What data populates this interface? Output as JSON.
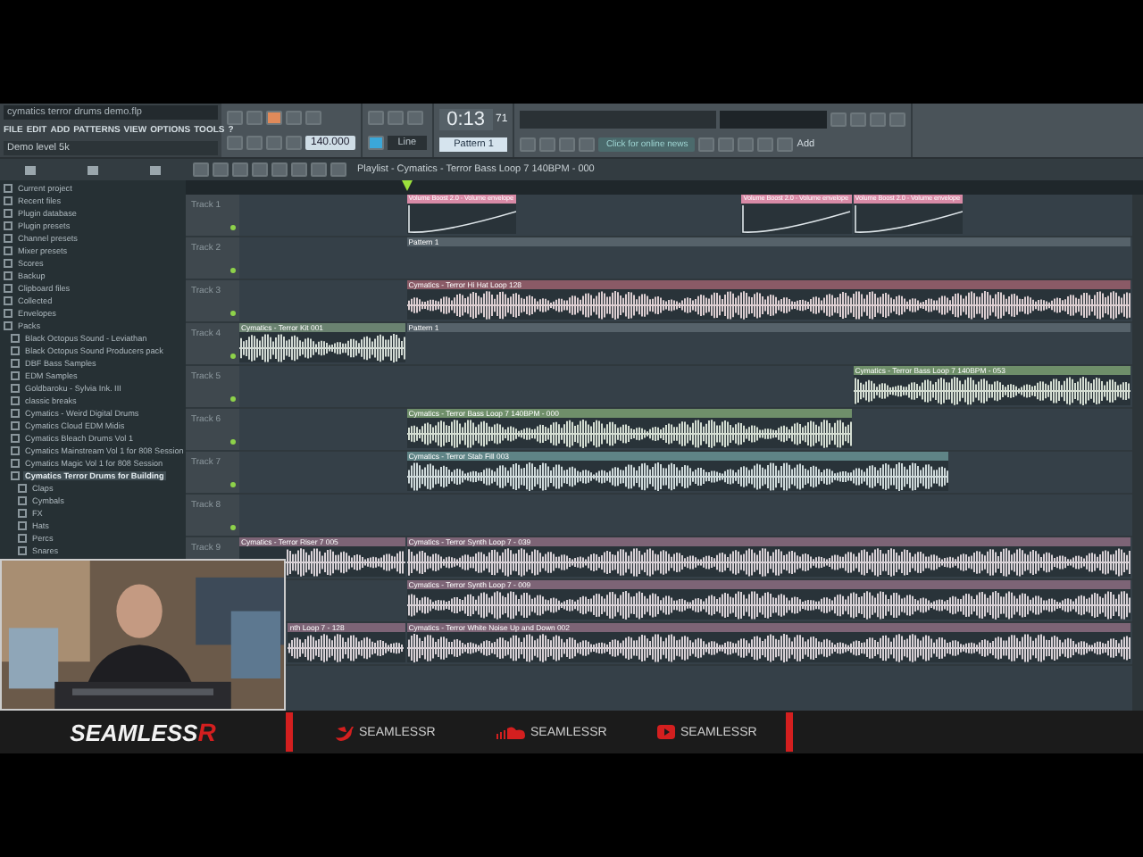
{
  "window": {
    "title": "cymatics terror drums demo.flp"
  },
  "menu": [
    "FILE",
    "EDIT",
    "ADD",
    "PATTERNS",
    "VIEW",
    "OPTIONS",
    "TOOLS",
    "?"
  ],
  "hint": "Demo level 5k",
  "transport": {
    "tempo": "140.000",
    "time": "0:13",
    "time_small": "71",
    "pattern": "Pattern 1",
    "snap": "Line",
    "news": "Click for online news",
    "add": "Add"
  },
  "browser": {
    "items": [
      {
        "label": "Current project",
        "selected": false
      },
      {
        "label": "Recent files",
        "selected": false
      },
      {
        "label": "Plugin database",
        "selected": false
      },
      {
        "label": "Plugin presets",
        "selected": false
      },
      {
        "label": "Channel presets",
        "selected": false
      },
      {
        "label": "Mixer presets",
        "selected": false
      },
      {
        "label": "Scores",
        "selected": false
      },
      {
        "label": "Backup",
        "selected": false
      },
      {
        "label": "Clipboard files",
        "selected": false
      },
      {
        "label": "Collected",
        "selected": false
      },
      {
        "label": "Envelopes",
        "selected": false
      },
      {
        "label": "Packs",
        "selected": false,
        "children": [
          {
            "label": "Black Octopus Sound - Leviathan",
            "selected": false
          },
          {
            "label": "Black Octopus Sound Producers pack",
            "selected": false
          },
          {
            "label": "DBF Bass Samples",
            "selected": false
          },
          {
            "label": "EDM Samples",
            "selected": false
          },
          {
            "label": "Goldbaroku - Sylvia Ink. III",
            "selected": false
          },
          {
            "label": "classic breaks",
            "selected": false
          },
          {
            "label": "Cymatics - Weird Digital Drums",
            "selected": false
          },
          {
            "label": "Cymatics Cloud EDM Midis",
            "selected": false
          },
          {
            "label": "Cymatics Bleach Drums Vol 1",
            "selected": false
          },
          {
            "label": "Cymatics Mainstream Vol 1 for 808 Session",
            "selected": false
          },
          {
            "label": "Cymatics Magic Vol 1 for 808 Session",
            "selected": false
          },
          {
            "label": "Cymatics Terror Drums for Building",
            "selected": true,
            "children": [
              {
                "label": "Claps",
                "selected": false
              },
              {
                "label": "Cymbals",
                "selected": false
              },
              {
                "label": "FX",
                "selected": false
              },
              {
                "label": "Hats",
                "selected": false
              },
              {
                "label": "Percs",
                "selected": false
              },
              {
                "label": "Snares",
                "selected": false
              }
            ]
          }
        ]
      }
    ]
  },
  "playlist": {
    "title": "Playlist - Cymatics - Terror Bass Loop 7 140BPM - 000",
    "playhead": {
      "level": 0.1875
    },
    "tracks": [
      {
        "label": "Track 1",
        "muted": false,
        "clips": [
          {
            "kind": "automation",
            "label": "Volume Boost 2.0 - Volume envelope",
            "color": "#d88aa6"
          },
          {
            "kind": "automation",
            "label": "Volume Boost 2.0 - Volume envelope",
            "color": "#d88aa6"
          },
          {
            "kind": "automation",
            "label": "Volume Boost 2.0 - Volume envelope",
            "color": "#d88aa6"
          }
        ]
      },
      {
        "label": "Track 2",
        "muted": false,
        "clips": [
          {
            "kind": "pattern",
            "label": "Pattern 1",
            "color": "#56626a"
          }
        ]
      },
      {
        "label": "Track 3",
        "muted": false,
        "clips": [
          {
            "kind": "audio",
            "label": "Cymatics - Terror Hi Hat Loop 128",
            "color": "#8a5a66"
          }
        ]
      },
      {
        "label": "Track 4",
        "muted": false,
        "clips": [
          {
            "kind": "audio",
            "label": "Cymatics - Terror Kit 001",
            "color": "#6a8270"
          },
          {
            "kind": "pattern",
            "label": "Pattern 1",
            "color": "#56626a"
          }
        ]
      },
      {
        "label": "Track 5",
        "muted": false,
        "clips": [
          {
            "kind": "audio",
            "label": "Cymatics - Terror Bass Loop 7 140BPM - 053",
            "color": "#6f8f6a"
          }
        ]
      },
      {
        "label": "Track 6",
        "muted": false,
        "clips": [
          {
            "kind": "audio",
            "label": "Cymatics - Terror Bass Loop 7 140BPM - 000",
            "color": "#6f8f6a"
          }
        ]
      },
      {
        "label": "Track 7",
        "muted": false,
        "clips": [
          {
            "kind": "audio",
            "label": "Cymatics - Terror Stab Fill 003",
            "color": "#5f8486"
          }
        ]
      },
      {
        "label": "Track 8",
        "muted": false
      },
      {
        "label": "Track 9",
        "clips": [
          {
            "kind": "audio",
            "label": "Cymatics - Terror Riser 7 005",
            "color": "#7d6476"
          },
          {
            "kind": "audio",
            "label": "Cymatics - Terror Synth Loop 7 - 039",
            "color": "#7d6476"
          }
        ]
      },
      {
        "clips": [
          {
            "kind": "audio",
            "label": "Cymatics - Terror Synth Loop 7 - 009",
            "color": "#7d6476"
          }
        ]
      },
      {
        "clips": [
          {
            "kind": "audio",
            "label": "nth Loop 7 - 128",
            "color": "#7d6476"
          },
          {
            "kind": "audio",
            "label": "Cymatics - Terror White Noise Up and Down 002",
            "color": "#7d6476"
          }
        ]
      }
    ]
  },
  "overlay": {
    "logo": "SEAMLESS",
    "logo_suffix": "R",
    "socials": [
      {
        "kind": "twitter",
        "handle": "SEAMLESSR"
      },
      {
        "kind": "soundcloud",
        "handle": "SEAMLESSR"
      },
      {
        "kind": "youtube",
        "handle": "SEAMLESSR"
      }
    ]
  }
}
